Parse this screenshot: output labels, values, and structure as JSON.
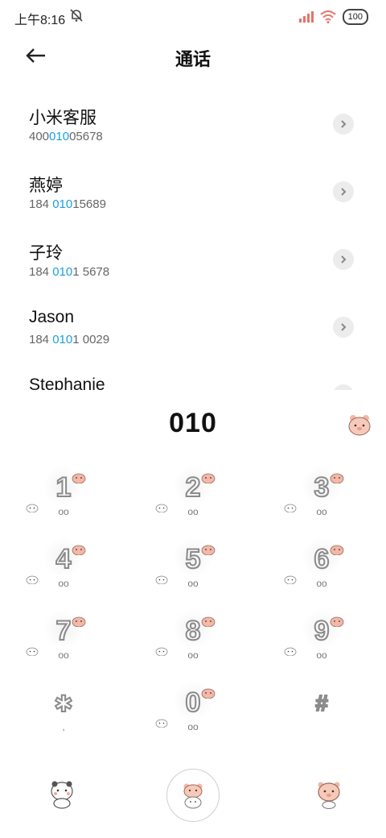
{
  "status_bar": {
    "time": "上午8:16",
    "battery": "100"
  },
  "header": {
    "title": "通话"
  },
  "results": [
    {
      "name": "小米客服",
      "pre": "400",
      "match": "010",
      "post": "05678"
    },
    {
      "name": "燕婷",
      "pre": "184 ",
      "match": "010",
      "post": "15689"
    },
    {
      "name": "子玲",
      "pre": "184 ",
      "match": "010",
      "post": "1 5678"
    },
    {
      "name": "Jason",
      "pre": "184 ",
      "match": "010",
      "post": "1 0029"
    },
    {
      "name": "Stephanie",
      "pre": "",
      "match": "",
      "post": ""
    }
  ],
  "dial": {
    "digits": "010"
  },
  "keys": [
    {
      "digit": "1",
      "sub": "oo"
    },
    {
      "digit": "2",
      "sub": "oo"
    },
    {
      "digit": "3",
      "sub": "oo"
    },
    {
      "digit": "4",
      "sub": "oo"
    },
    {
      "digit": "5",
      "sub": "oo"
    },
    {
      "digit": "6",
      "sub": "oo"
    },
    {
      "digit": "7",
      "sub": "oo"
    },
    {
      "digit": "8",
      "sub": "oo"
    },
    {
      "digit": "9",
      "sub": "oo"
    },
    {
      "digit": "✱",
      "sub": ","
    },
    {
      "digit": "0",
      "sub": "oo"
    },
    {
      "digit": "#",
      "sub": ""
    }
  ],
  "icons": {
    "back": "arrow-left-icon",
    "mute": "bell-off-icon",
    "chevron": "chevron-right-icon",
    "pig": "pig-sticker-icon",
    "bun": "bunny-sticker-icon"
  },
  "colors": {
    "accent": "#1a9fe0",
    "signal": "#e8736a",
    "pig": "#f3b8a8"
  }
}
